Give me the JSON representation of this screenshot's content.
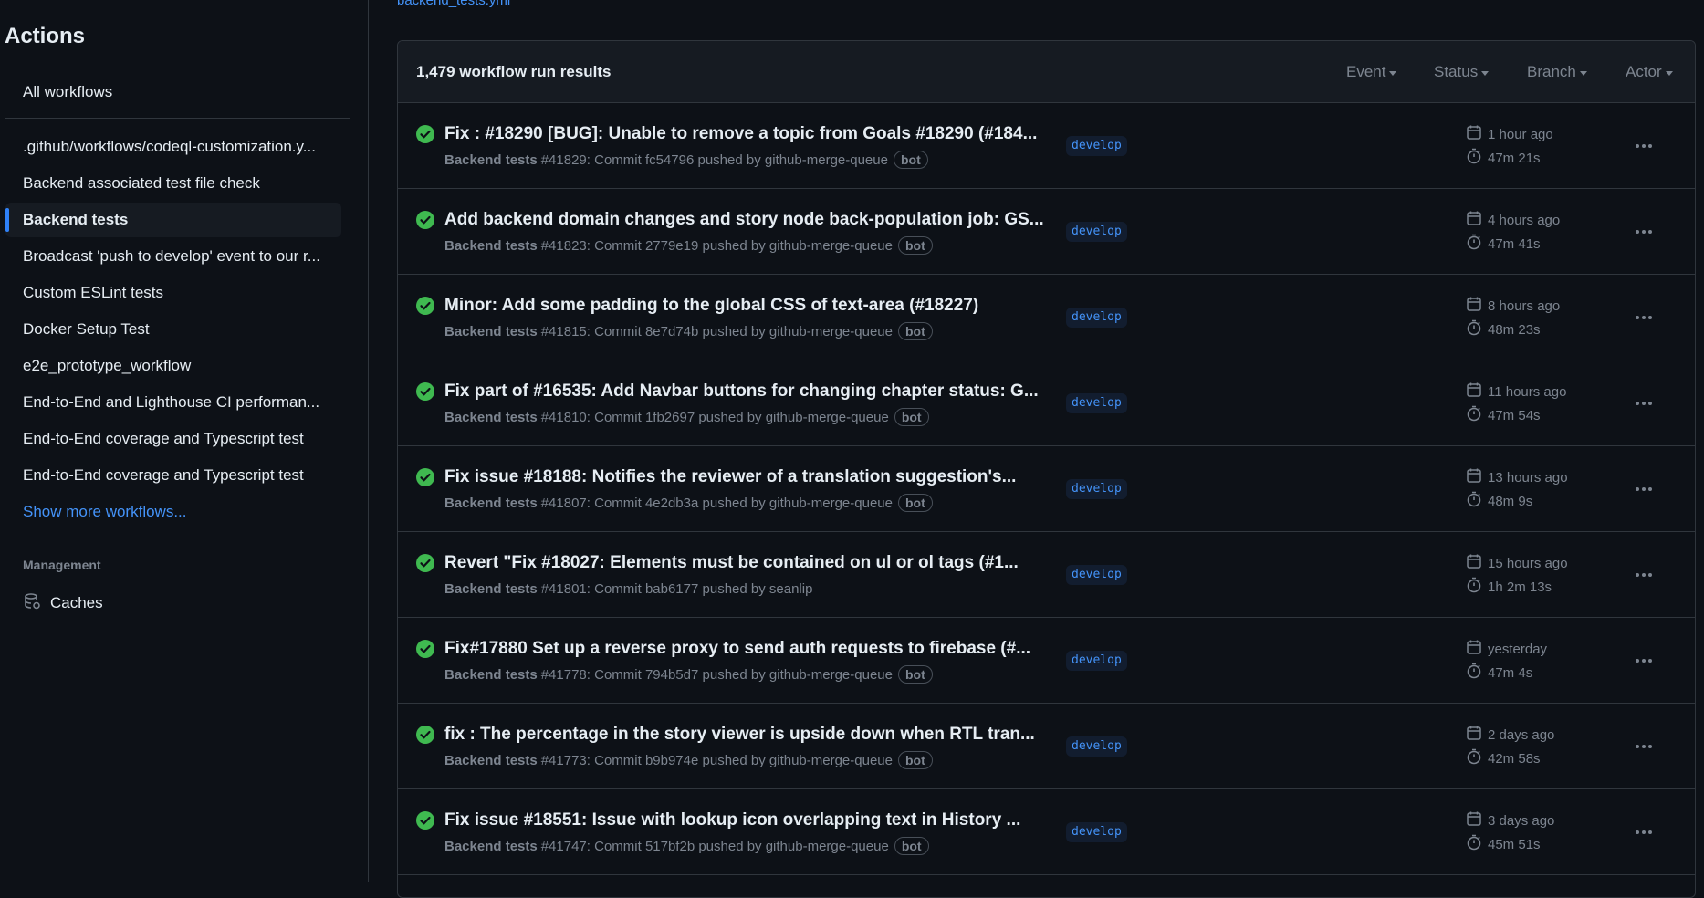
{
  "sidebar": {
    "title": "Actions",
    "all_workflows": "All workflows",
    "workflows": [
      ".github/workflows/codeql-customization.y...",
      "Backend associated test file check",
      "Backend tests",
      "Broadcast 'push to develop' event to our r...",
      "Custom ESLint tests",
      "Docker Setup Test",
      "e2e_prototype_workflow",
      "End-to-End and Lighthouse CI performan...",
      "End-to-End coverage and Typescript test",
      "End-to-End coverage and Typescript test"
    ],
    "show_more": "Show more workflows...",
    "management_heading": "Management",
    "caches": "Caches"
  },
  "main": {
    "file_link": "backend_tests.yml",
    "results_count": "1,479 workflow run results",
    "filters": [
      "Event",
      "Status",
      "Branch",
      "Actor"
    ],
    "runs": [
      {
        "title": "Fix : #18290 [BUG]: Unable to remove a topic from Goals #18290 (#184...",
        "workflow": "Backend tests",
        "meta": "#41829: Commit fc54796 pushed by github-merge-queue",
        "bot": "bot",
        "branch": "develop",
        "when": "1 hour ago",
        "duration": "47m 21s"
      },
      {
        "title": "Add backend domain changes and story node back-population job: GS...",
        "workflow": "Backend tests",
        "meta": "#41823: Commit 2779e19 pushed by github-merge-queue",
        "bot": "bot",
        "branch": "develop",
        "when": "4 hours ago",
        "duration": "47m 41s"
      },
      {
        "title": "Minor: Add some padding to the global CSS of text-area (#18227)",
        "workflow": "Backend tests",
        "meta": "#41815: Commit 8e7d74b pushed by github-merge-queue",
        "bot": "bot",
        "branch": "develop",
        "when": "8 hours ago",
        "duration": "48m 23s"
      },
      {
        "title": "Fix part of #16535: Add Navbar buttons for changing chapter status: G...",
        "workflow": "Backend tests",
        "meta": "#41810: Commit 1fb2697 pushed by github-merge-queue",
        "bot": "bot",
        "branch": "develop",
        "when": "11 hours ago",
        "duration": "47m 54s"
      },
      {
        "title": "Fix issue #18188: Notifies the reviewer of a translation suggestion's...",
        "workflow": "Backend tests",
        "meta": "#41807: Commit 4e2db3a pushed by github-merge-queue",
        "bot": "bot",
        "branch": "develop",
        "when": "13 hours ago",
        "duration": "48m 9s"
      },
      {
        "title": "Revert \"Fix #18027: Elements must be contained on ul or ol tags (#1...",
        "workflow": "Backend tests",
        "meta": "#41801: Commit bab6177 pushed by seanlip",
        "bot": "",
        "branch": "develop",
        "when": "15 hours ago",
        "duration": "1h 2m 13s"
      },
      {
        "title": "Fix#17880 Set up a reverse proxy to send auth requests to firebase (#...",
        "workflow": "Backend tests",
        "meta": "#41778: Commit 794b5d7 pushed by github-merge-queue",
        "bot": "bot",
        "branch": "develop",
        "when": "yesterday",
        "duration": "47m 4s"
      },
      {
        "title": "fix : The percentage in the story viewer is upside down when RTL tran...",
        "workflow": "Backend tests",
        "meta": "#41773: Commit b9b974e pushed by github-merge-queue",
        "bot": "bot",
        "branch": "develop",
        "when": "2 days ago",
        "duration": "42m 58s"
      },
      {
        "title": "Fix issue #18551: Issue with lookup icon overlapping text in History ...",
        "workflow": "Backend tests",
        "meta": "#41747: Commit 517bf2b pushed by github-merge-queue",
        "bot": "bot",
        "branch": "develop",
        "when": "3 days ago",
        "duration": "45m 51s"
      }
    ]
  },
  "colors": {
    "background": "#0d1117",
    "surface": "#161b22",
    "border": "#30363d",
    "link": "#4493f8",
    "success": "#3fb950",
    "muted": "#7d8590",
    "active_marker": "#2f81f7"
  },
  "icons": {
    "status": "check-circle-icon",
    "calendar": "calendar-icon",
    "duration": "stopwatch-icon",
    "menu": "kebab-horizontal-icon",
    "caches": "database-icon"
  }
}
